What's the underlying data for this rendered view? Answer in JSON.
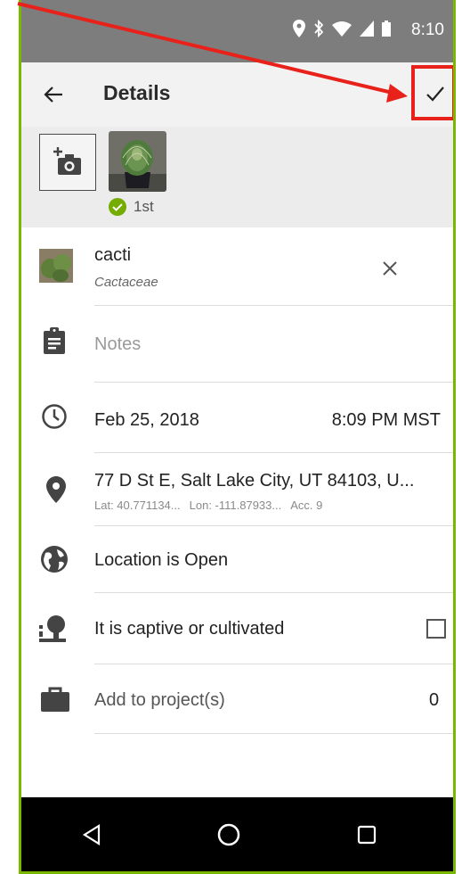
{
  "status_bar": {
    "time": "8:10"
  },
  "header": {
    "title": "Details"
  },
  "photos": {
    "badge_label": "1st"
  },
  "taxon": {
    "common_name": "cacti",
    "scientific_name": "Cactaceae"
  },
  "notes": {
    "placeholder": "Notes"
  },
  "datetime": {
    "date": "Feb 25, 2018",
    "time": "8:09 PM MST"
  },
  "location": {
    "address": "77 D St E, Salt Lake City, UT 84103, U...",
    "lat": "Lat: 40.771134...",
    "lon": "Lon: -111.87933...",
    "acc": "Acc. 9"
  },
  "geoprivacy": {
    "label": "Location is Open"
  },
  "captive": {
    "label": "It is captive or cultivated",
    "checked": false
  },
  "projects": {
    "label": "Add to project(s)",
    "count": "0"
  },
  "colors": {
    "accent": "#7ab800",
    "highlight": "#e8211a",
    "status_bar": "#7d7d7d"
  },
  "icons": [
    "back-arrow-icon",
    "check-icon",
    "add-photo-icon",
    "check-circle-icon",
    "close-icon",
    "clipboard-icon",
    "clock-icon",
    "location-pin-icon",
    "globe-icon",
    "captive-tree-icon",
    "briefcase-icon",
    "nav-back-icon",
    "nav-home-icon",
    "nav-recents-icon"
  ]
}
